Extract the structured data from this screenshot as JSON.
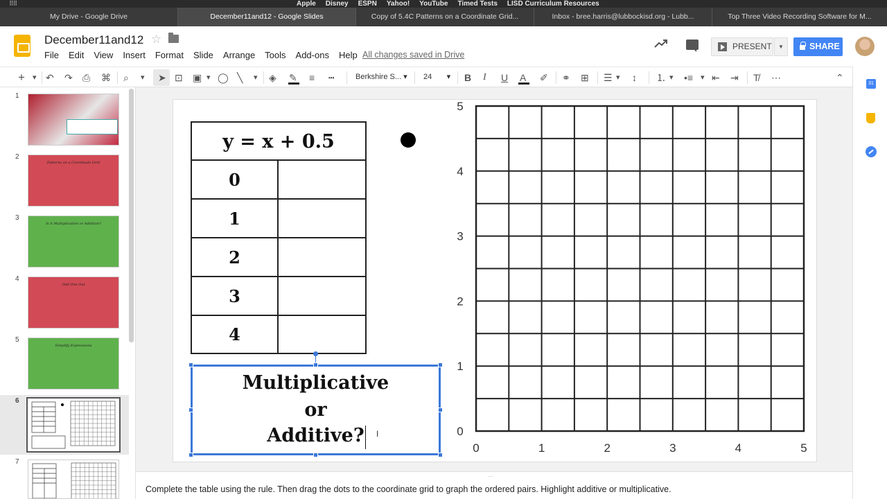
{
  "bookmarks": [
    "Apple",
    "Disney",
    "ESPN",
    "Yahoo!",
    "YouTube",
    "Timed Tests",
    "LISD Curriculum Resources"
  ],
  "tabs": [
    {
      "label": "My Drive - Google Drive"
    },
    {
      "label": "December11and12 - Google Slides"
    },
    {
      "label": "Copy of 5.4C Patterns on a Coordinate Grid..."
    },
    {
      "label": "Inbox - bree.harris@lubbockisd.org - Lubb..."
    },
    {
      "label": "Top Three Video Recording Software for M..."
    }
  ],
  "header": {
    "title": "December11and12",
    "menu": [
      "File",
      "Edit",
      "View",
      "Insert",
      "Format",
      "Slide",
      "Arrange",
      "Tools",
      "Add-ons",
      "Help"
    ],
    "saved_status": "All changes saved in Drive",
    "present_label": "PRESENT",
    "share_label": "SHARE"
  },
  "toolbar": {
    "font": "Berkshire S...",
    "font_size": "24"
  },
  "filmstrip": {
    "numbers": [
      "1",
      "2",
      "3",
      "4",
      "5",
      "6",
      "7"
    ],
    "slide_titles": [
      "",
      "Patterns on a Coordinate Grid",
      "Is it Multiplication or Addition?",
      "Odd One Out",
      "Simplify Expressions"
    ],
    "colors": [
      "#c1223a",
      "#d24a55",
      "#5fb14c",
      "#d24a55",
      "#5fb14c"
    ]
  },
  "slide": {
    "rule": "y = x + 0.5",
    "x_values": [
      "0",
      "1",
      "2",
      "3",
      "4"
    ],
    "question_lines": [
      "Multiplicative",
      "or",
      "Additive?"
    ]
  },
  "chart_data": {
    "type": "scatter",
    "x_ticks": [
      "0",
      "1",
      "2",
      "3",
      "4",
      "5"
    ],
    "y_ticks": [
      "0",
      "1",
      "2",
      "3",
      "4",
      "5"
    ],
    "xlim": [
      0,
      5
    ],
    "ylim": [
      0,
      5
    ],
    "grid": true,
    "grid_step": 0.5,
    "points": []
  },
  "notes": {
    "text": "Complete the table using the rule. Then drag the dots to the coordinate grid to graph the ordered pairs. Highlight additive or multiplicative."
  }
}
